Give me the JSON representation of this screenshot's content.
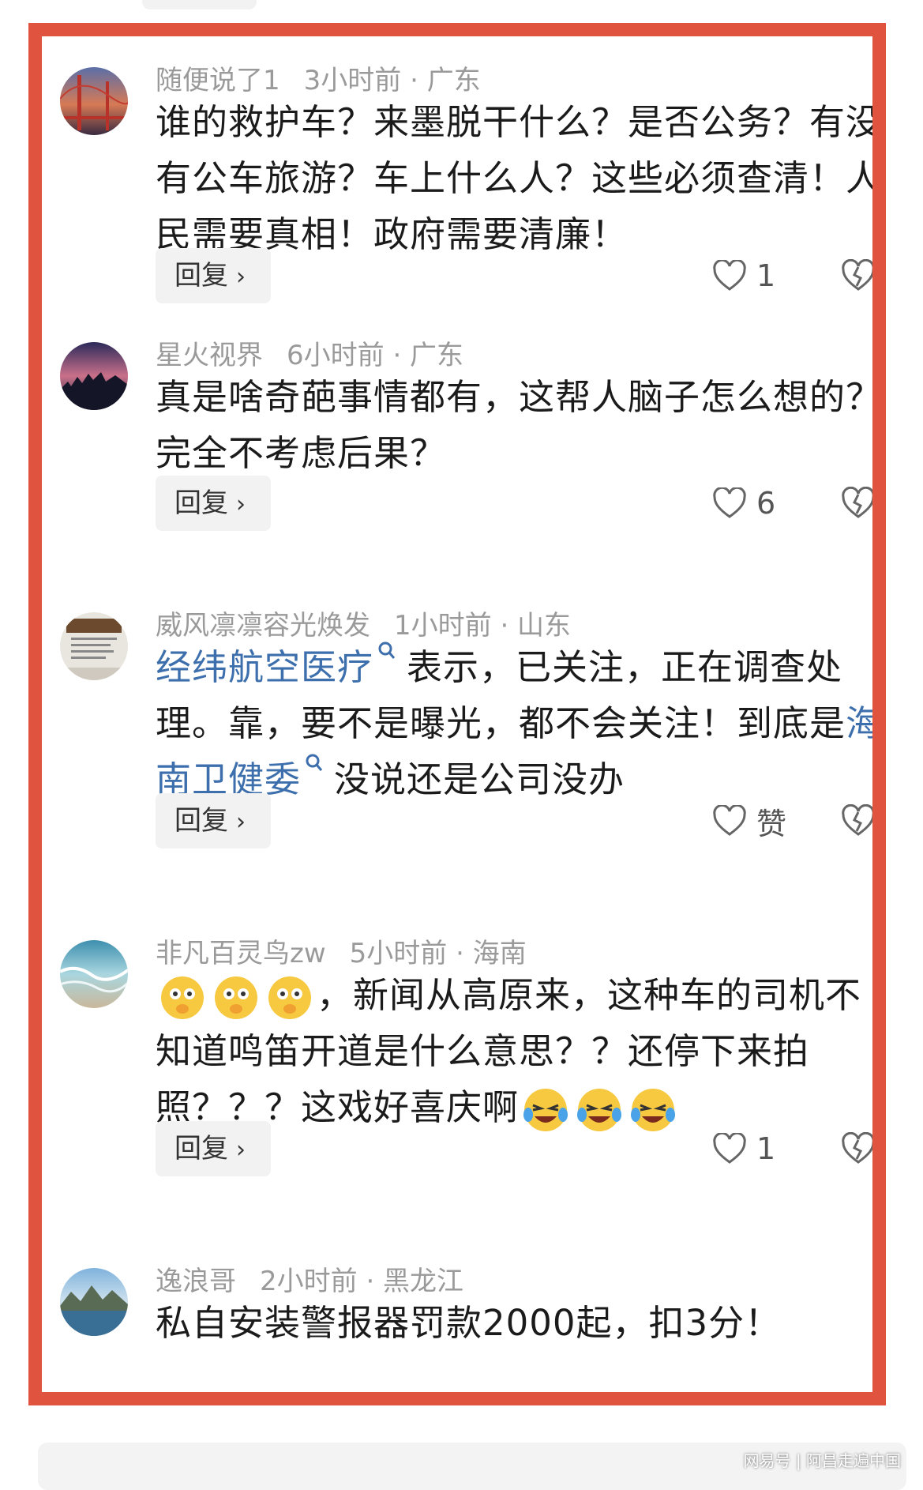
{
  "comments": [
    {
      "user": "随便说了1",
      "time": "3小时前 · 广东",
      "text": "谁的救护车？来墨脱干什么？是否公务？有没有公车旅游？车上什么人？这些必须查清！人民需要真相！政府需要清廉！",
      "reply_label": "回复",
      "likes": "1"
    },
    {
      "user": "星火视界",
      "time": "6小时前 · 广东",
      "text": "真是啥奇葩事情都有，这帮人脑子怎么想的？完全不考虑后果？",
      "reply_label": "回复",
      "likes": "6"
    },
    {
      "user": "威风凛凛容光焕发",
      "time": "1小时前 · 山东",
      "link1": "经纬航空医疗",
      "text_a": "表示，已关注，正在调查处理。靠，要不是曝光，都不会关注！到底是",
      "link2": "海南卫健委",
      "text_b": "没说还是公司没办",
      "reply_label": "回复",
      "likes": "赞"
    },
    {
      "user": "非凡百灵鸟zw",
      "time": "5小时前 · 海南",
      "text_a": "，新闻从高原来，这种车的司机不知道鸣笛开道是什么意思？？还停下来拍照？？？这戏好喜庆啊",
      "reply_label": "回复",
      "likes": "1"
    },
    {
      "user": "逸浪哥",
      "time": "2小时前 · 黑龙江",
      "text": "私自安装警报器罚款2000起，扣3分！"
    }
  ],
  "watermark": "网易号 | 阿昌走遍中国",
  "colors": {
    "frame": "#e0533f",
    "link": "#3d6fad",
    "meta": "#9a9a9a"
  }
}
